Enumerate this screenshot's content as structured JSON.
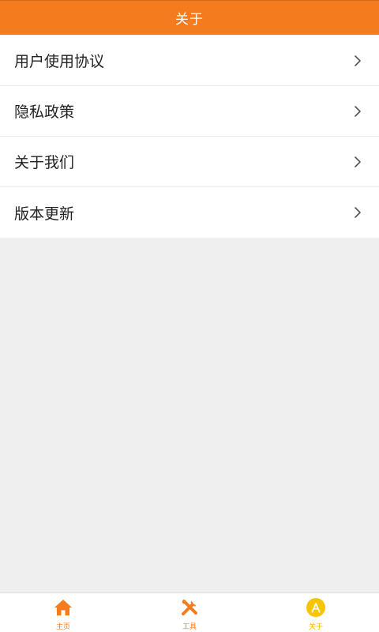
{
  "header": {
    "title": "关于"
  },
  "menu": {
    "items": [
      {
        "label": "用户使用协议"
      },
      {
        "label": "隐私政策"
      },
      {
        "label": "关于我们"
      },
      {
        "label": "版本更新"
      }
    ]
  },
  "tabbar": {
    "tabs": [
      {
        "label": "主页",
        "icon": "home-icon"
      },
      {
        "label": "工具",
        "icon": "tools-icon"
      },
      {
        "label": "关于",
        "icon": "about-icon",
        "active": true
      }
    ]
  },
  "colors": {
    "accent": "#f47c1f",
    "active_tab": "#f7c400",
    "background": "#efefef"
  }
}
